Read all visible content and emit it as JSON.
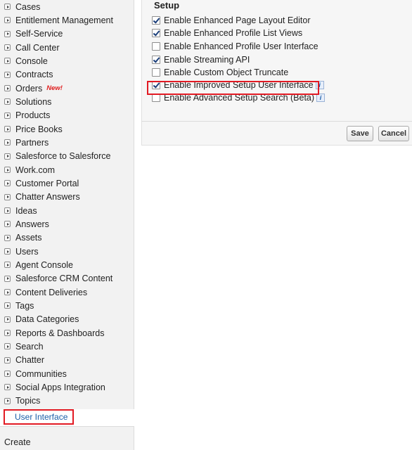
{
  "sidebar": {
    "items": [
      {
        "label": "Cases"
      },
      {
        "label": "Entitlement Management"
      },
      {
        "label": "Self-Service"
      },
      {
        "label": "Call Center"
      },
      {
        "label": "Console"
      },
      {
        "label": "Contracts"
      },
      {
        "label": "Orders",
        "badge": "New!"
      },
      {
        "label": "Solutions"
      },
      {
        "label": "Products"
      },
      {
        "label": "Price Books"
      },
      {
        "label": "Partners"
      },
      {
        "label": "Salesforce to Salesforce"
      },
      {
        "label": "Work.com"
      },
      {
        "label": "Customer Portal"
      },
      {
        "label": "Chatter Answers"
      },
      {
        "label": "Ideas"
      },
      {
        "label": "Answers"
      },
      {
        "label": "Assets"
      },
      {
        "label": "Users"
      },
      {
        "label": "Agent Console"
      },
      {
        "label": "Salesforce CRM Content"
      },
      {
        "label": "Content Deliveries"
      },
      {
        "label": "Tags"
      },
      {
        "label": "Data Categories"
      },
      {
        "label": "Reports & Dashboards"
      },
      {
        "label": "Search"
      },
      {
        "label": "Chatter"
      },
      {
        "label": "Communities"
      },
      {
        "label": "Social Apps Integration"
      },
      {
        "label": "Topics"
      }
    ],
    "selected": "User Interface",
    "section_create": "Create"
  },
  "setup": {
    "title": "Setup",
    "options": [
      {
        "label": "Enable Enhanced Page Layout Editor",
        "checked": true,
        "info": false
      },
      {
        "label": "Enable Enhanced Profile List Views",
        "checked": true,
        "info": false
      },
      {
        "label": "Enable Enhanced Profile User Interface",
        "checked": false,
        "info": false
      },
      {
        "label": "Enable Streaming API",
        "checked": true,
        "info": false
      },
      {
        "label": "Enable Custom Object Truncate",
        "checked": false,
        "info": false
      },
      {
        "label": "Enable Improved Setup User Interface",
        "checked": true,
        "info": true
      },
      {
        "label": "Enable Advanced Setup Search (Beta)",
        "checked": false,
        "info": true
      }
    ],
    "info_glyph": "i",
    "save_label": "Save",
    "cancel_label": "Cancel"
  },
  "colors": {
    "highlight": "#e21a23",
    "link": "#1b5ea8",
    "new_badge": "#e01f1f"
  }
}
